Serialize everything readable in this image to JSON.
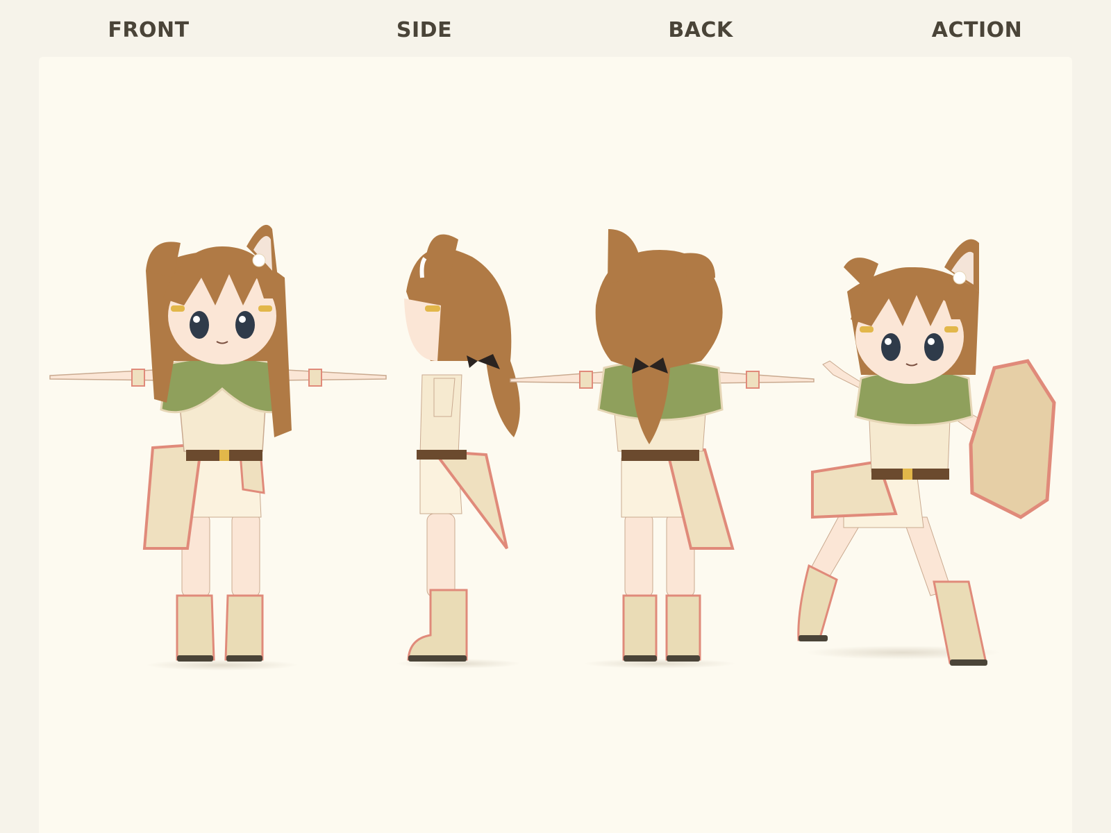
{
  "views": [
    {
      "id": "front",
      "label": "FRONT"
    },
    {
      "id": "side",
      "label": "SIDE"
    },
    {
      "id": "back",
      "label": "BACK"
    },
    {
      "id": "action",
      "label": "ACTION"
    }
  ],
  "palette": {
    "background": "#f6f3ea",
    "canvas": "#fdfaf0",
    "label": "#4a4438",
    "hair": "#b07a45",
    "hair_dark": "#8a5a30",
    "skin": "#fbe6d6",
    "cape": "#8fa05c",
    "cloth": "#efe0bf",
    "trim": "#e08a7a",
    "belt": "#6b4a2e",
    "boot": "#eadcb6",
    "eye": "#2f3b4a"
  }
}
